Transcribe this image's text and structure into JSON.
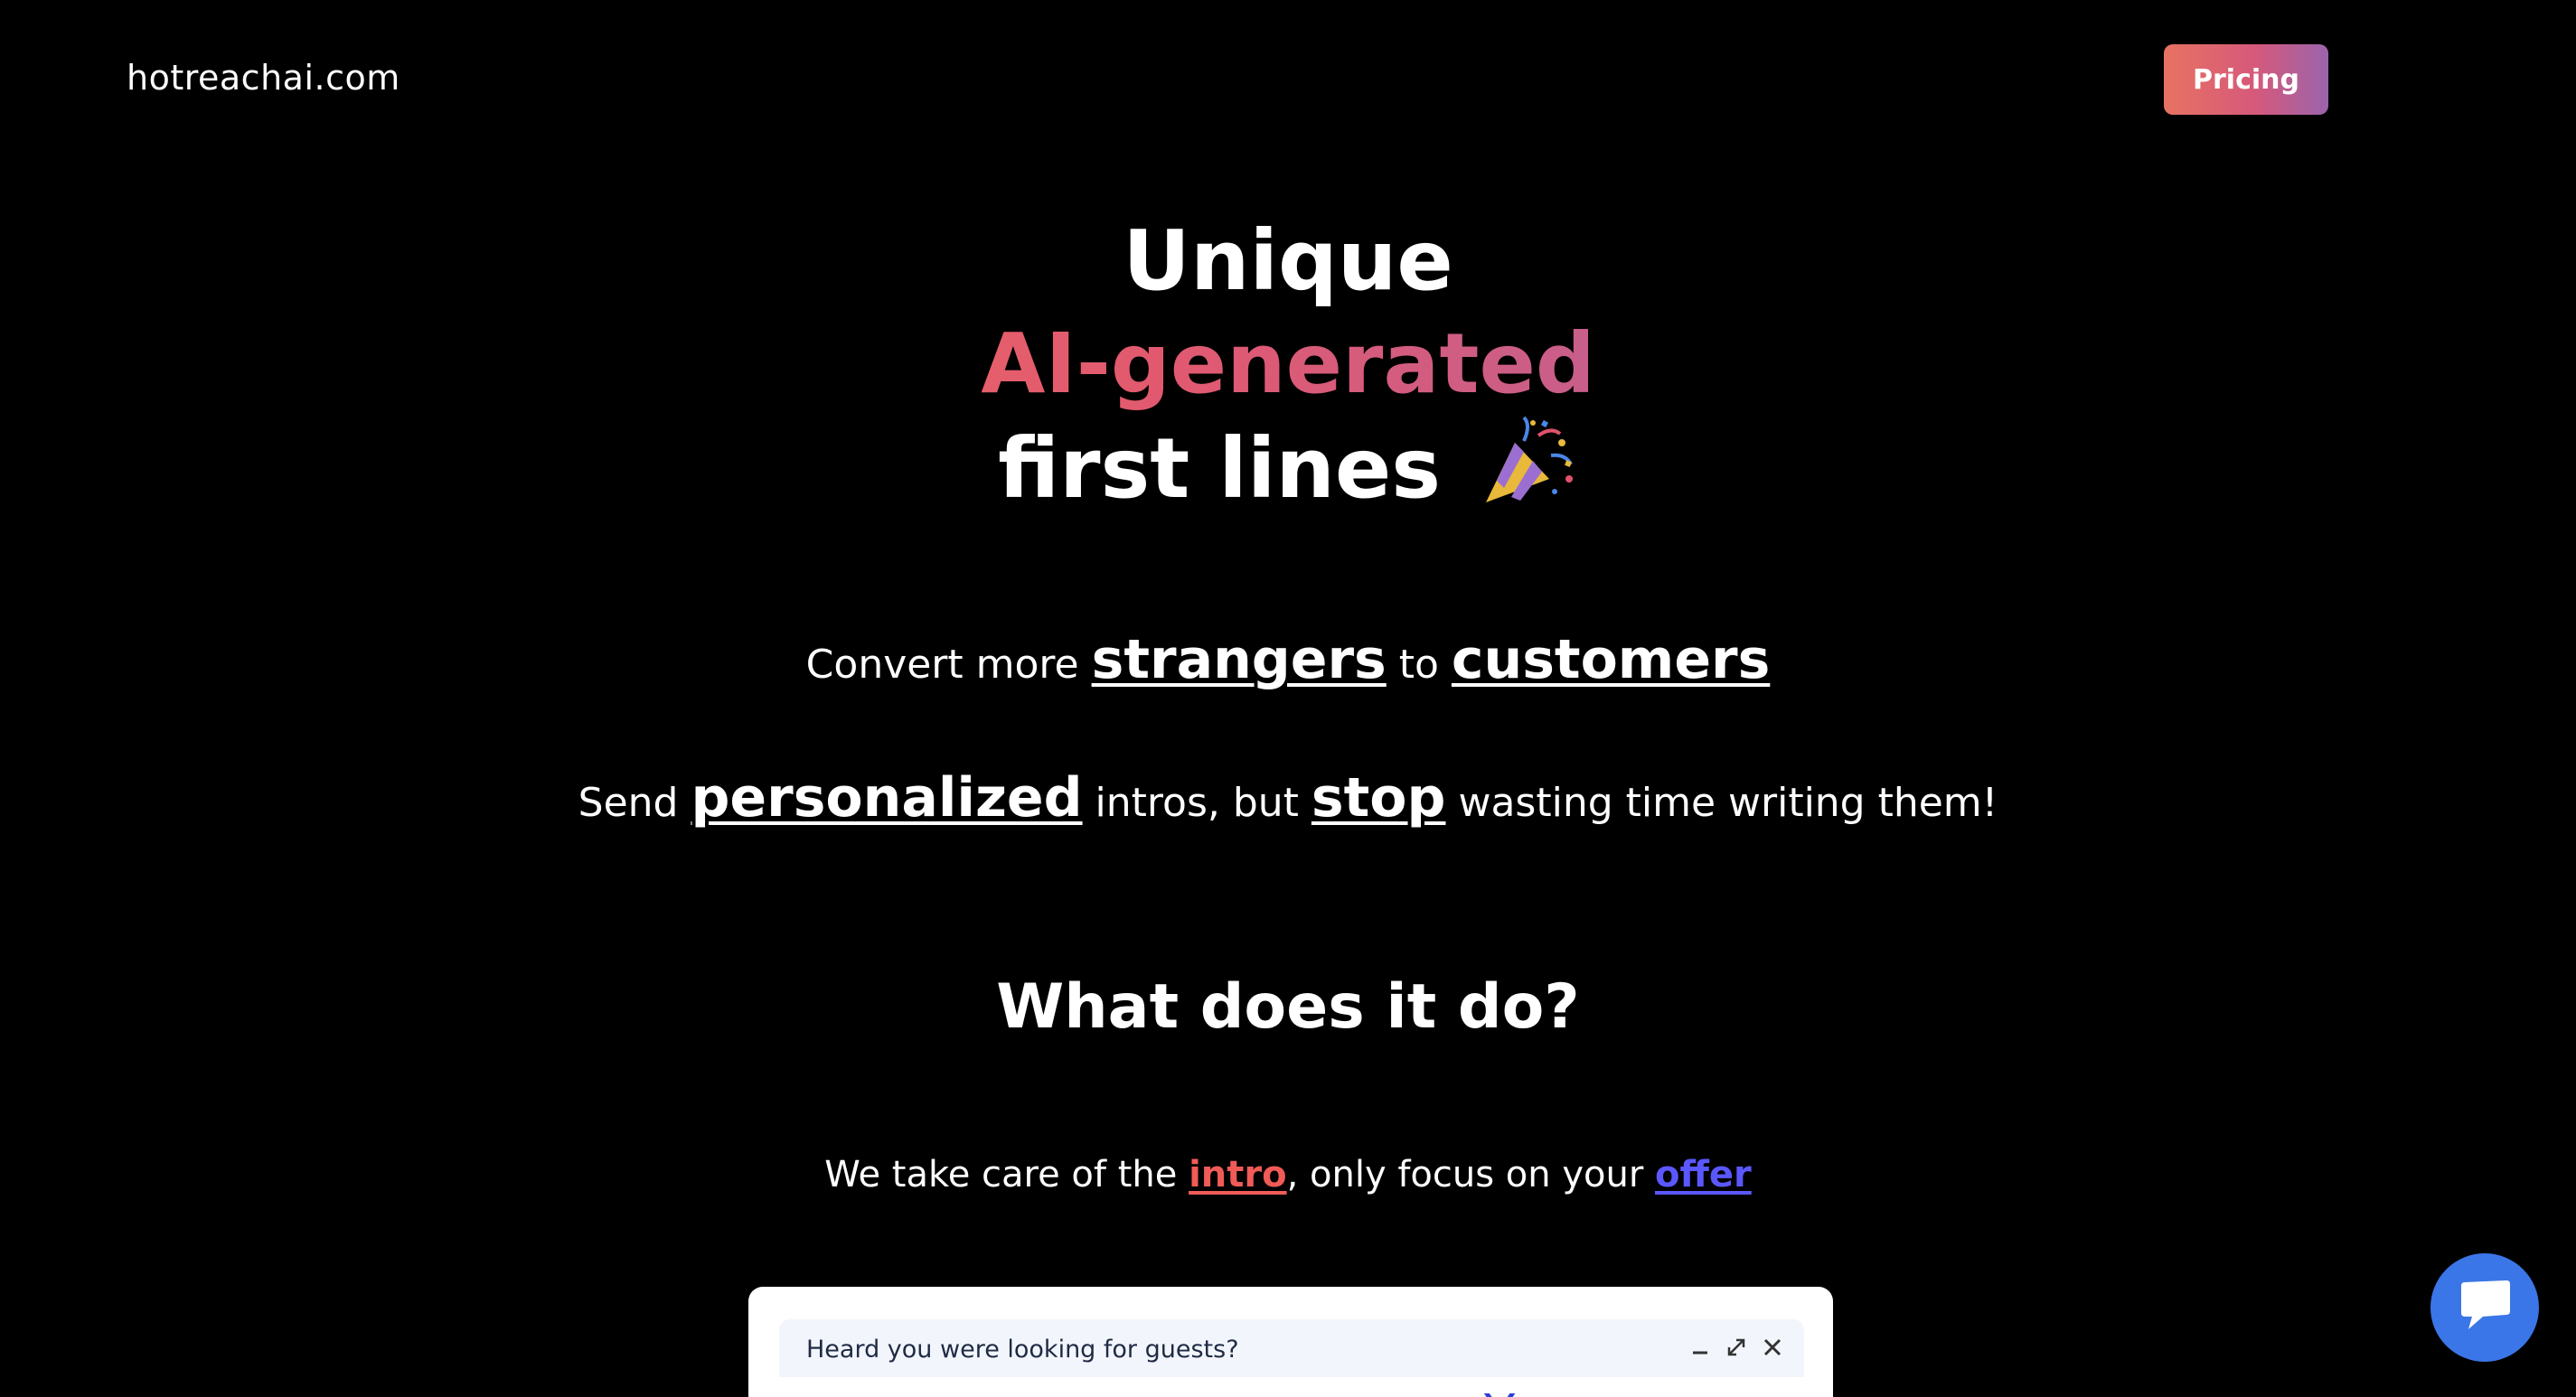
{
  "header": {
    "site_title": "hotreachai.com",
    "pricing_label": "Pricing"
  },
  "hero": {
    "line1": "Unique",
    "line2": "AI-generated",
    "line3": "first lines",
    "icon": "party-popper-icon"
  },
  "subheading1": {
    "part1": "Convert more ",
    "emph1": "strangers",
    "part2": " to ",
    "emph2": "customers"
  },
  "subheading2": {
    "part1": "Send ",
    "emph1": "personalized",
    "part2": " intros, but ",
    "emph2": "stop",
    "part3": " wasting time writing them!"
  },
  "section": {
    "heading": "What does it do?"
  },
  "care": {
    "part1": "We take care of the ",
    "intro": "intro",
    "part2": ", only focus on your ",
    "offer": "offer"
  },
  "demo": {
    "compose_title": "Heard you were looking for guests?",
    "body_preview": "You"
  },
  "colors": {
    "accent_red": "#f05b57",
    "accent_blue": "#5b57ff",
    "chat_blue": "#3b76e8"
  }
}
